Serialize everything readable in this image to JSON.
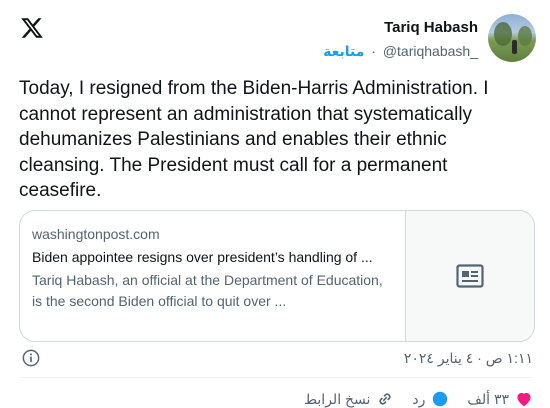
{
  "author": {
    "name": "Tariq Habash",
    "handle": "@tariqhabash_",
    "follow_label": "متابعة",
    "separator": "·"
  },
  "tweet": {
    "text": "Today, I resigned from the Biden-Harris Administration. I cannot represent an administration that systematically dehumanizes Palestinians and enables their ethnic cleansing. The President must call for a permanent ceasefire."
  },
  "card": {
    "domain": "washingtonpost.com",
    "title": "Biden appointee resigns over president’s handling of ...",
    "description": "Tariq Habash, an official at the Department of Education, is the second Biden official to quit over ..."
  },
  "timestamp": "١:١١ ص · ٤ يناير ٢٠٢٤",
  "actions": {
    "likes": "٣٣ ألف",
    "reply_label": "رد",
    "copy_link_label": "نسخ الرابط"
  },
  "colors": {
    "accent": "#1d9bf0",
    "like": "#f91880",
    "text": "#0f1419",
    "muted": "#536471"
  },
  "icons": [
    "x-logo-icon",
    "article-icon",
    "info-icon",
    "heart-icon",
    "reply-icon",
    "link-icon"
  ]
}
